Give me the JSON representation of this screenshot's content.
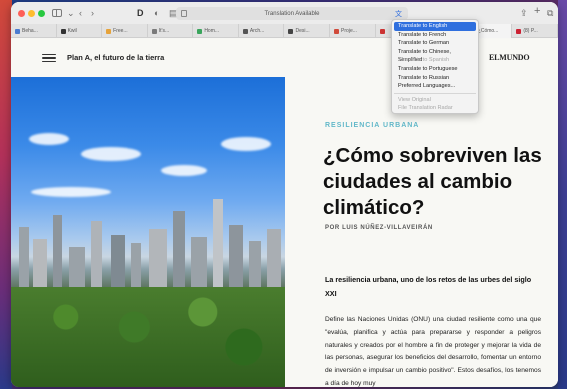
{
  "browser": {
    "address_bar": "Translation Available",
    "tabs": [
      {
        "label": "Beha...",
        "color": "#4a7bd0"
      },
      {
        "label": "Kwil",
        "color": "#333333"
      },
      {
        "label": "Free...",
        "color": "#e6a33a"
      },
      {
        "label": "It's...",
        "color": "#7a7a7a"
      },
      {
        "label": "Hom...",
        "color": "#3aa55c"
      },
      {
        "label": "Arch...",
        "color": "#555555"
      },
      {
        "label": "Desi...",
        "color": "#444444"
      },
      {
        "label": "Proje...",
        "color": "#d04a3a"
      },
      {
        "label": "",
        "color": "#cc3333"
      },
      {
        "label": "",
        "color": "#888888"
      },
      {
        "label": "¿Cómo...",
        "color": "#3a7ad0",
        "active": true
      },
      {
        "label": "(8) P...",
        "color": "#cc2233"
      }
    ]
  },
  "translate_menu": {
    "items": [
      {
        "label": "Translate to English",
        "state": "selected"
      },
      {
        "label": "Translate to French",
        "state": "normal"
      },
      {
        "label": "Translate to German",
        "state": "normal"
      },
      {
        "label": "Translate to Chinese, Simplified",
        "state": "normal"
      },
      {
        "label": "Translate to Spanish",
        "state": "disabled"
      },
      {
        "label": "Translate to Portuguese",
        "state": "normal"
      },
      {
        "label": "Translate to Russian",
        "state": "normal"
      },
      {
        "label": "Preferred Languages...",
        "state": "normal"
      }
    ],
    "footer_items": [
      {
        "label": "View Original",
        "state": "disabled"
      },
      {
        "label": "File Translation Radar",
        "state": "disabled"
      }
    ]
  },
  "site": {
    "section_title": "Plan A, el futuro de la tierra",
    "logo": "ELMUNDO"
  },
  "article": {
    "kicker": "RESILIENCIA URBANA",
    "headline": "¿Cómo sobreviven las ciudades al cambio climático?",
    "byline": "POR LUIS NÚÑEZ-VILLAVEIRÁN",
    "lead": "La resiliencia urbana, uno de los retos de las urbes del siglo XXI",
    "body": "Define las Naciones Unidas (ONU) una ciudad resiliente como una que \"evalúa, planifica y actúa para prepararse y responder a peligros naturales y creados por el hombre a fin de proteger y mejorar la vida de las personas, asegurar los beneficios del desarrollo, fomentar un entorno de inversión e impulsar un cambio positivo\". Estos desafíos, los tenemos a día de hoy muy"
  },
  "colors": {
    "kicker": "#62b8c9",
    "menu_selected": "#2f6fde"
  }
}
